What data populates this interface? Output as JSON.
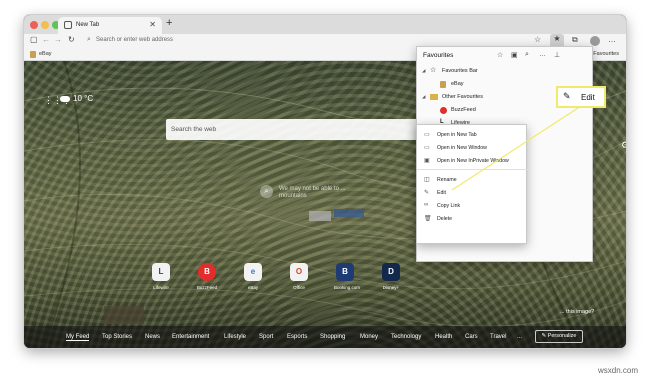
{
  "tab": {
    "title": "New Tab"
  },
  "toolbar": {
    "address_placeholder": "Search or enter web address"
  },
  "bookmarks_bar": {
    "left_item": "eBay",
    "right_item": "Other Favourites"
  },
  "new_tab_page": {
    "weather": "10 °C",
    "search_placeholder": "Search the web",
    "image_caption": "We may not be able to ... mountains",
    "image_question": "... this image?",
    "quick_links": [
      "Lifewire",
      "BuzzFeed",
      "eBay",
      "Office",
      "Booking.com",
      "Disney+"
    ],
    "quick_link_letters": [
      "L",
      "B",
      "e",
      "O",
      "B",
      "D"
    ],
    "feed_tabs": [
      "My Feed",
      "Top Stories",
      "News",
      "Entertainment",
      "Lifestyle",
      "Sport",
      "Esports",
      "Shopping",
      "Money",
      "Technology",
      "Health",
      "Cars",
      "Travel",
      "..."
    ],
    "personalize_label": "Personalize"
  },
  "favourites_panel": {
    "title": "Favourites",
    "tree": [
      {
        "label": "Favourites Bar",
        "icon": "star-icon",
        "level": 0
      },
      {
        "label": "eBay",
        "icon": "ebay-icon",
        "level": 1
      },
      {
        "label": "Other Favourites",
        "icon": "folder-icon",
        "level": 0
      },
      {
        "label": "BuzzFeed",
        "icon": "buzzfeed-icon",
        "level": 1
      },
      {
        "label": "Lifewire",
        "icon": "lifewire-icon",
        "level": 1
      }
    ]
  },
  "context_menu": {
    "items": [
      {
        "label": "Open in New Tab",
        "icon": "new-tab-icon"
      },
      {
        "label": "Open in New Window",
        "icon": "new-window-icon"
      },
      {
        "label": "Open in New InPrivate Window",
        "icon": "inprivate-icon"
      },
      {
        "label": "Rename",
        "icon": "rename-icon"
      },
      {
        "label": "Edit",
        "icon": "pencil-icon"
      },
      {
        "label": "Copy Link",
        "icon": "link-icon"
      },
      {
        "label": "Delete",
        "icon": "trash-icon"
      }
    ]
  },
  "callout": {
    "label": "Edit"
  },
  "watermark": "wsxdn.com",
  "colors": {
    "accent": "#0078d4",
    "callout_border": "#f1e96a",
    "buzzfeed_red": "#e32c2c"
  }
}
